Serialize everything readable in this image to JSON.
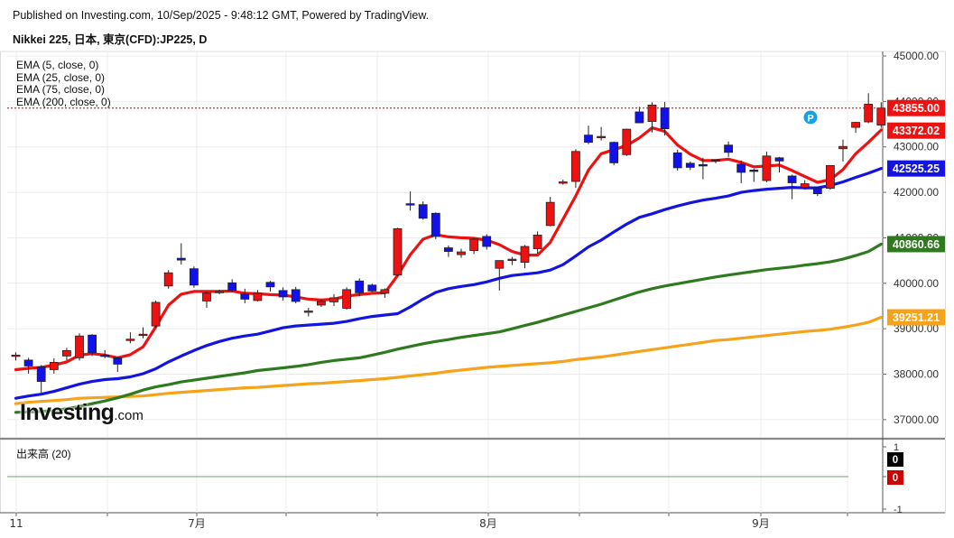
{
  "header": {
    "published": "Published on Investing.com, 10/Sep/2025 - 9:48:12 GMT, Powered by TradingView.",
    "symbol": "Nikkei 225, 日本, 東京(CFD):JP225, D"
  },
  "legend": {
    "ema5": "EMA (5, close, 0)",
    "ema25": "EMA (25, close, 0)",
    "ema75": "EMA (75, close, 0)",
    "ema200": "EMA (200, close, 0)"
  },
  "volume": {
    "label": "出来高 (20)",
    "axis": [
      "1",
      "0",
      "-1"
    ],
    "value_tags": [
      "0",
      "0"
    ]
  },
  "logo": {
    "main": "Investing",
    "suffix": ".com"
  },
  "colors": {
    "up": "#ee1111",
    "down": "#1111ee",
    "ema5": "#ee1111",
    "ema25": "#1414e0",
    "ema75": "#2f7a1f",
    "ema200": "#f7a21b"
  },
  "chart_data": {
    "type": "candlestick",
    "y_axis": {
      "min": 36600,
      "max": 45100,
      "ticks": [
        37000,
        38000,
        39000,
        40000,
        41000,
        42000,
        43000,
        44000,
        45000
      ],
      "tick_labels": [
        "37000.00",
        "38000.00",
        "39000.00",
        "40000.00",
        "41000.00",
        "42000.00",
        "43000.00",
        "44000.00",
        "45000.00"
      ]
    },
    "x_labels": [
      "11",
      "7月",
      "8月",
      "9月"
    ],
    "last_price_line": 43855,
    "price_tags": [
      {
        "value": 43855.0,
        "label": "43855.00",
        "series": "close"
      },
      {
        "value": 43372.02,
        "label": "43372.02",
        "series": "ema5"
      },
      {
        "value": 42525.25,
        "label": "42525.25",
        "series": "ema25"
      },
      {
        "value": 40860.66,
        "label": "40860.66",
        "series": "ema75"
      },
      {
        "value": 39251.21,
        "label": "39251.21",
        "series": "ema200"
      }
    ],
    "candles": [
      [
        38400,
        38480,
        38300,
        38420
      ],
      [
        38310,
        38360,
        38010,
        38180
      ],
      [
        38160,
        38200,
        37590,
        37840
      ],
      [
        38100,
        38350,
        38010,
        38260
      ],
      [
        38400,
        38580,
        38300,
        38520
      ],
      [
        38360,
        38900,
        38300,
        38840
      ],
      [
        38860,
        38880,
        38400,
        38470
      ],
      [
        38420,
        38530,
        38350,
        38410
      ],
      [
        38360,
        38390,
        38050,
        38220
      ],
      [
        38770,
        38920,
        38680,
        38770
      ],
      [
        38880,
        39030,
        38790,
        38880
      ],
      [
        39060,
        39620,
        39020,
        39580
      ],
      [
        39940,
        40290,
        39880,
        40230
      ],
      [
        40550,
        40880,
        40410,
        40510
      ],
      [
        40320,
        40370,
        39900,
        39960
      ],
      [
        39610,
        39810,
        39460,
        39780
      ],
      [
        39810,
        39860,
        39760,
        39820
      ],
      [
        40010,
        40090,
        39810,
        39840
      ],
      [
        39760,
        39880,
        39560,
        39650
      ],
      [
        39620,
        39850,
        39600,
        39780
      ],
      [
        40020,
        40050,
        39820,
        39920
      ],
      [
        39840,
        39910,
        39620,
        39700
      ],
      [
        39860,
        39920,
        39560,
        39600
      ],
      [
        39390,
        39460,
        39270,
        39390
      ],
      [
        39520,
        39640,
        39480,
        39600
      ],
      [
        39590,
        39760,
        39500,
        39680
      ],
      [
        39450,
        39910,
        39420,
        39860
      ],
      [
        40050,
        40110,
        39710,
        39790
      ],
      [
        39960,
        39990,
        39810,
        39830
      ],
      [
        39780,
        39890,
        39680,
        39860
      ],
      [
        40180,
        41220,
        40160,
        41200
      ],
      [
        41750,
        42020,
        41600,
        41730
      ],
      [
        41730,
        41800,
        41400,
        41430
      ],
      [
        41540,
        41560,
        40970,
        41030
      ],
      [
        40780,
        40830,
        40580,
        40700
      ],
      [
        40630,
        40760,
        40560,
        40690
      ],
      [
        40720,
        41000,
        40640,
        40970
      ],
      [
        41030,
        41080,
        40740,
        40810
      ],
      [
        40330,
        40440,
        39840,
        40500
      ],
      [
        40520,
        40580,
        40400,
        40530
      ],
      [
        40460,
        40840,
        40330,
        40810
      ],
      [
        40760,
        41140,
        40660,
        41060
      ],
      [
        41270,
        41900,
        41250,
        41780
      ],
      [
        42210,
        42280,
        42170,
        42230
      ],
      [
        42240,
        42950,
        42100,
        42900
      ],
      [
        43260,
        43470,
        43060,
        43100
      ],
      [
        43200,
        43440,
        43140,
        43230
      ],
      [
        43100,
        43120,
        42600,
        42650
      ],
      [
        42830,
        43400,
        42800,
        43390
      ],
      [
        43770,
        43880,
        43520,
        43530
      ],
      [
        43560,
        43980,
        43320,
        43920
      ],
      [
        43860,
        43990,
        43250,
        43400
      ],
      [
        42870,
        42940,
        42480,
        42540
      ],
      [
        42640,
        42680,
        42490,
        42550
      ],
      [
        42610,
        42760,
        42290,
        42590
      ],
      [
        42720,
        42720,
        42640,
        42700
      ],
      [
        43040,
        43120,
        42780,
        42880
      ],
      [
        42620,
        42700,
        42200,
        42440
      ],
      [
        42490,
        42520,
        42230,
        42460
      ],
      [
        42260,
        42900,
        42220,
        42800
      ],
      [
        42760,
        42780,
        42440,
        42690
      ],
      [
        42360,
        42390,
        41850,
        42210
      ],
      [
        42110,
        42270,
        42060,
        42190
      ],
      [
        42100,
        42110,
        41920,
        41970
      ],
      [
        42090,
        42600,
        42060,
        42590
      ],
      [
        42960,
        43160,
        42680,
        43010
      ],
      [
        43430,
        43550,
        43310,
        43540
      ],
      [
        43550,
        44180,
        43520,
        43940
      ],
      [
        43480,
        43980,
        43420,
        43855
      ]
    ],
    "series": [
      {
        "name": "EMA (5, close, 0)",
        "values": [
          38100,
          38130,
          38150,
          38200,
          38270,
          38420,
          38450,
          38420,
          38360,
          38430,
          38600,
          39040,
          39520,
          39760,
          39820,
          39820,
          39820,
          39830,
          39780,
          39770,
          39750,
          39740,
          39700,
          39650,
          39630,
          39650,
          39720,
          39750,
          39780,
          39790,
          40170,
          40630,
          40970,
          41070,
          41020,
          41000,
          40990,
          40950,
          40850,
          40700,
          40620,
          40620,
          40900,
          41410,
          41920,
          42490,
          42850,
          42940,
          43030,
          43200,
          43420,
          43340,
          43040,
          42840,
          42700,
          42700,
          42730,
          42660,
          42560,
          42580,
          42600,
          42480,
          42350,
          42220,
          42280,
          42500,
          42850,
          43100,
          43372.02
        ]
      },
      {
        "name": "EMA (25, close, 0)",
        "values": [
          37470,
          37520,
          37560,
          37620,
          37700,
          37780,
          37840,
          37880,
          37900,
          37940,
          38010,
          38120,
          38270,
          38400,
          38520,
          38630,
          38720,
          38790,
          38840,
          38880,
          38950,
          39020,
          39060,
          39080,
          39100,
          39120,
          39160,
          39220,
          39270,
          39300,
          39330,
          39480,
          39650,
          39800,
          39880,
          39930,
          39970,
          40030,
          40110,
          40170,
          40200,
          40230,
          40290,
          40410,
          40600,
          40800,
          40950,
          41130,
          41300,
          41450,
          41530,
          41620,
          41700,
          41770,
          41830,
          41870,
          41920,
          42000,
          42040,
          42070,
          42090,
          42110,
          42100,
          42100,
          42150,
          42230,
          42330,
          42420,
          42525.25
        ]
      },
      {
        "name": "EMA (75, close, 0)",
        "values": [
          37160,
          37170,
          37180,
          37200,
          37240,
          37290,
          37350,
          37410,
          37480,
          37560,
          37650,
          37720,
          37770,
          37830,
          37870,
          37910,
          37950,
          37990,
          38030,
          38080,
          38110,
          38140,
          38170,
          38210,
          38260,
          38300,
          38330,
          38360,
          38420,
          38480,
          38550,
          38610,
          38670,
          38720,
          38760,
          38810,
          38850,
          38890,
          38930,
          39000,
          39070,
          39140,
          39220,
          39300,
          39380,
          39460,
          39540,
          39630,
          39720,
          39810,
          39880,
          39940,
          39990,
          40040,
          40090,
          40140,
          40180,
          40220,
          40260,
          40300,
          40330,
          40360,
          40400,
          40430,
          40470,
          40530,
          40610,
          40700,
          40860.66
        ]
      },
      {
        "name": "EMA (200, close, 0)",
        "values": [
          37350,
          37380,
          37400,
          37420,
          37440,
          37470,
          37480,
          37490,
          37500,
          37510,
          37520,
          37550,
          37580,
          37600,
          37620,
          37640,
          37660,
          37680,
          37700,
          37710,
          37730,
          37750,
          37770,
          37790,
          37800,
          37820,
          37840,
          37860,
          37880,
          37900,
          37930,
          37960,
          37990,
          38020,
          38060,
          38090,
          38120,
          38150,
          38170,
          38190,
          38210,
          38230,
          38250,
          38280,
          38320,
          38350,
          38380,
          38420,
          38460,
          38500,
          38540,
          38580,
          38620,
          38660,
          38700,
          38740,
          38760,
          38790,
          38820,
          38850,
          38880,
          38910,
          38940,
          38960,
          38990,
          39030,
          39080,
          39140,
          39251.21
        ]
      }
    ],
    "markers": [
      {
        "label": "P"
      }
    ]
  }
}
